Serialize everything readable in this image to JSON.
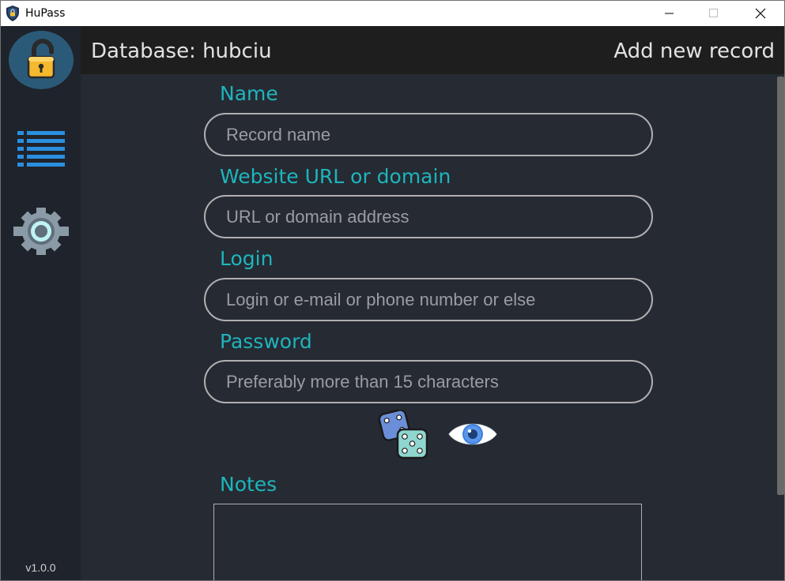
{
  "window": {
    "title": "HuPass"
  },
  "sidebar": {
    "lock_icon": "unlocked-padlock-icon",
    "list_icon": "list-icon",
    "settings_icon": "gear-icon",
    "version": "v1.0.0"
  },
  "header": {
    "database_label": "Database: hubciu",
    "page_title": "Add new record"
  },
  "form": {
    "name": {
      "label": "Name",
      "placeholder": "Record name",
      "value": ""
    },
    "website": {
      "label": "Website URL or domain",
      "placeholder": "URL or domain address",
      "value": ""
    },
    "login": {
      "label": "Login",
      "placeholder": "Login or e-mail or phone number or else",
      "value": ""
    },
    "password": {
      "label": "Password",
      "placeholder": "Preferably more than 15 characters",
      "value": ""
    },
    "generate_icon": "dice-icon",
    "reveal_icon": "eye-icon",
    "notes": {
      "label": "Notes",
      "value": ""
    }
  },
  "colors": {
    "accent": "#1eb5bc",
    "background": "#262a33",
    "sidebar": "#1f232b",
    "header": "#1e1e1e"
  }
}
